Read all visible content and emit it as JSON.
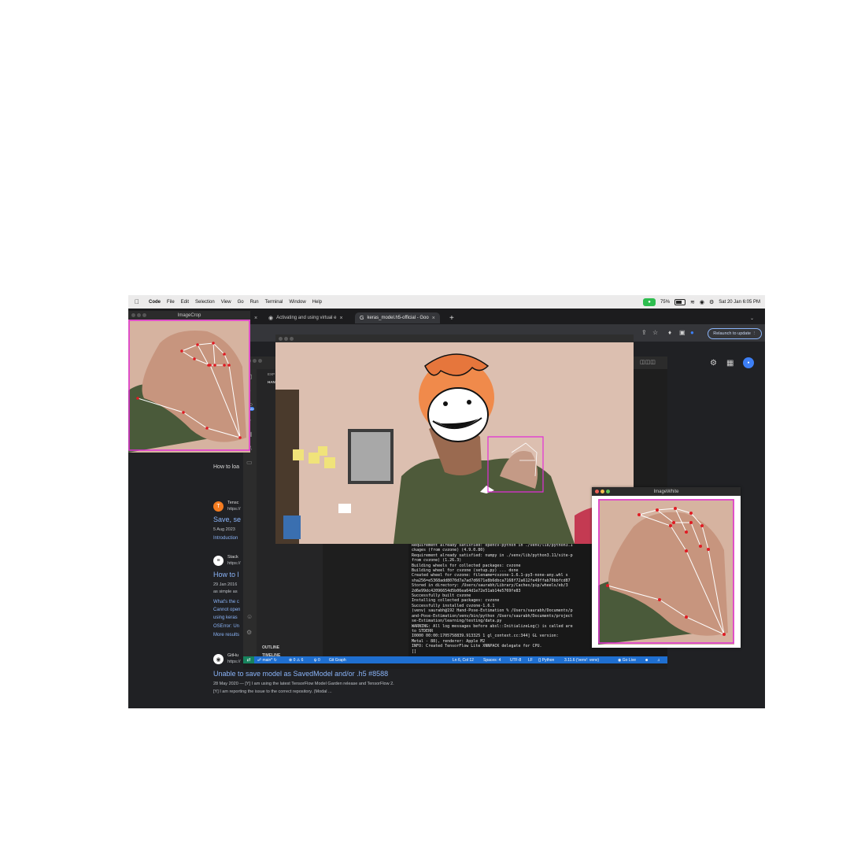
{
  "menubar": {
    "app": "Code",
    "items": [
      "File",
      "Edit",
      "Selection",
      "View",
      "Go",
      "Run",
      "Terminal",
      "Window",
      "Help"
    ],
    "battery": "75%",
    "datetime": "Sat 20 Jan  6:05 PM"
  },
  "browser": {
    "tabs": [
      {
        "label": "Activating and using virtual e"
      },
      {
        "label": "keras_model.h5-official - Goo"
      }
    ],
    "partial_tab": "_model.h5",
    "relaunch_label": "Relaunch to update"
  },
  "google": {
    "partial_heading": "How to loa",
    "results": [
      {
        "site": "Tensc",
        "url": "https://",
        "title": "Save, se",
        "date": "5 Aug 2023",
        "extra": "Introduction"
      },
      {
        "site": "Stack",
        "url": "https://",
        "title": "How to l",
        "date": "29 Jan 2016",
        "snippet": "as simple as",
        "links": [
          "What's the c",
          "Cannot open",
          "using keras",
          "OSError: Un",
          "More results"
        ]
      },
      {
        "site": "GitHu",
        "url": "https://",
        "title": "Unable to save model as SavedModel and/or .h5 #8588",
        "date_line": "28 May 2020 — [Y] I am using the latest TensorFlow Model Garden release and TensorFlow 2.",
        "line2": "[Y] I am reporting the issue to the correct repository. (Modal ..."
      }
    ]
  },
  "vscode": {
    "sidebar_header": "EXP",
    "sidebar_sub": "HAN",
    "outline": "OUTLINE",
    "timeline": "TIMELINE",
    "badge_count": "20",
    "terminal_lines": [
      "Requirement already satisfied: opencv-python in ./venv/lib/python3.1",
      "ckages (from cvzone) (4.9.0.80)",
      "Requirement already satisfied: numpy in ./venv/lib/python3.11/site-p",
      "from cvzone) (1.26.3)",
      "Building wheels for collected packages: cvzone",
      "  Building wheel for cvzone (setup.py) ... done",
      "  Created wheel for cvzone: filename=cvzone-1.6.1-py3-none-any.whl s",
      "  sha256=e5368add8070d7a7ad7d6671e8b6dbca7168f72a612fe49ffab70bbfcd87",
      "  Stored in directory: /Users/saurabh/Library/Caches/pip/wheels/eb/3",
      "2d6e99dc42096654d5b06ea64d1e72e51ab14e5769fe83",
      "Successfully built cvzone",
      "Installing collected packages: cvzone",
      "Successfully installed cvzone-1.6.1",
      "(venv) saurabh@192 Hand-Pose-Estimation % /Users/saurabh/Documents/p",
      "and-Pose-Estimation/venv/bin/python /Users/saurabh/Documents/project",
      "se-Estimation/learning/testing/data.py",
      "WARNING: All log messages before absl::InitializeLog() is called are",
      "to STDERR",
      "I0000 00:00:1705758839.913325         1 gl_context.cc:344] GL version:",
      "  Metal - 88), renderer: Apple M2",
      "INFO: Created TensorFlow Lite XNNPACK delegate for CPU.",
      "[]"
    ],
    "status": {
      "branch": "main*",
      "errors": "0 ⚠ 6",
      "ports": "0",
      "git_graph": "Git Graph",
      "position": "Ln 6, Col 12",
      "spaces": "Spaces: 4",
      "encoding": "UTF-8",
      "eol": "LF",
      "language": "Python",
      "interpreter": "3.11.6 ('venv': venv)",
      "golive": "Go Live"
    }
  },
  "windows": {
    "crop_title": "ImageCrop",
    "white_title": "ImageWhite"
  },
  "colors": {
    "menubar_bg": "#ecebeb",
    "browser_bg": "#202124",
    "link": "#8ab4f8",
    "statusbar": "#1f6fd0",
    "bbox_magenta": "#e22fd6",
    "landmark_red": "#e01b24"
  },
  "icons": {
    "apple": "apple-icon",
    "wifi": "wifi-icon",
    "battery": "battery-icon",
    "camera": "camera-icon"
  }
}
